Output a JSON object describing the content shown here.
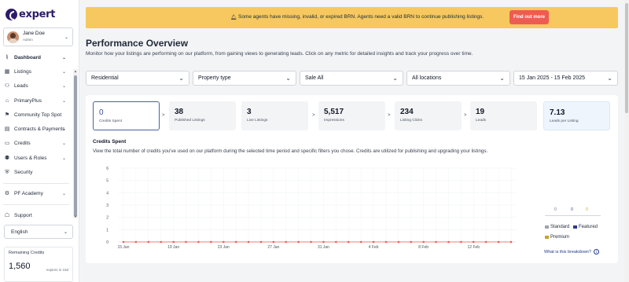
{
  "brand": {
    "name": "expert"
  },
  "user": {
    "name": "Jane Doe",
    "role": "Admin"
  },
  "nav": [
    {
      "label": "Dashboard",
      "icon": "chart-line-icon",
      "glyph": "⌇",
      "chevron": true,
      "active": true
    },
    {
      "label": "Listings",
      "icon": "building-icon",
      "glyph": "▦",
      "chevron": true
    },
    {
      "label": "Leads",
      "icon": "users-icon",
      "glyph": "⚇",
      "chevron": true
    },
    {
      "label": "PrimaryPlus",
      "icon": "primary-plus-icon",
      "glyph": "⌂",
      "chevron": true
    },
    {
      "label": "Community Top Spot",
      "icon": "community-icon",
      "glyph": "⚑",
      "chevron": false
    },
    {
      "label": "Contracts & Payments",
      "icon": "contracts-icon",
      "glyph": "▤",
      "chevron": true
    },
    {
      "label": "Credits",
      "icon": "credits-icon",
      "glyph": "▭",
      "chevron": true
    },
    {
      "label": "Users & Roles",
      "icon": "user-roles-icon",
      "glyph": "⚉",
      "chevron": true
    },
    {
      "label": "Security",
      "icon": "shield-icon",
      "glyph": "⛨",
      "chevron": false
    }
  ],
  "nav2": [
    {
      "label": "PF Academy",
      "icon": "academy-icon",
      "glyph": "⚙",
      "chevron": true
    }
  ],
  "nav3": [
    {
      "label": "Support",
      "icon": "support-icon",
      "glyph": "☖",
      "chevron": false
    }
  ],
  "language": {
    "value": "English"
  },
  "remaining_credits": {
    "title": "Remaining Credits",
    "value": "1,560",
    "expiry": "expires in 15d"
  },
  "banner": {
    "text": "Some agents have missing, invalid, or expired BRN. Agents need a valid BRN to continue publishing listings.",
    "button": "Find out more"
  },
  "page": {
    "title": "Performance Overview",
    "subtitle": "Monitor how your listings are performing on our platform, from gaining views to generating leads. Click on any metric for detailed insights and track your progress over time."
  },
  "filters": {
    "category": "Residential",
    "property_type": "Property type",
    "sale": "Sale All",
    "location": "All locations",
    "date_range": "15 Jan 2025 - 15 Feb 2025"
  },
  "metrics": [
    {
      "value": "0",
      "label": "Credits Spent"
    },
    {
      "value": "38",
      "label": "Published Listings"
    },
    {
      "value": "3",
      "label": "Live Listings"
    },
    {
      "value": "5,517",
      "label": "Impressions"
    },
    {
      "value": "234",
      "label": "Listing Clicks"
    },
    {
      "value": "19",
      "label": "Leads"
    },
    {
      "value": "7.13",
      "label": "Leads per Listing"
    }
  ],
  "section": {
    "title": "Credits Spent",
    "description": "View the total number of credits you've used on our platform during the selected time period and specific filters you chose. Credits are utilized for publishing and upgrading your listings."
  },
  "chart_data": {
    "type": "line",
    "title": "",
    "ylim": [
      0,
      6
    ],
    "yticks": [
      "0",
      "1",
      "2",
      "3",
      "4",
      "5",
      "6"
    ],
    "xticks": [
      "15 Jan",
      "19 Jan",
      "23 Jan",
      "27 Jan",
      "31 Jan",
      "4 Feb",
      "8 Feb",
      "12 Feb"
    ],
    "x": [
      "15 Jan",
      "16 Jan",
      "17 Jan",
      "18 Jan",
      "19 Jan",
      "20 Jan",
      "21 Jan",
      "22 Jan",
      "23 Jan",
      "24 Jan",
      "25 Jan",
      "26 Jan",
      "27 Jan",
      "28 Jan",
      "29 Jan",
      "30 Jan",
      "31 Jan",
      "1 Feb",
      "2 Feb",
      "3 Feb",
      "4 Feb",
      "5 Feb",
      "6 Feb",
      "7 Feb",
      "8 Feb",
      "9 Feb",
      "10 Feb",
      "11 Feb",
      "12 Feb",
      "13 Feb",
      "14 Feb",
      "15 Feb"
    ],
    "series": [
      {
        "values": [
          0,
          0,
          0,
          0,
          0,
          0,
          0,
          0,
          0,
          0,
          0,
          0,
          0,
          0,
          0,
          0,
          0,
          0,
          0,
          0,
          0,
          0,
          0,
          0,
          0,
          0,
          0,
          0,
          0,
          0,
          0,
          0
        ],
        "color": "#ef5b52"
      }
    ],
    "grid": true
  },
  "legend": {
    "totals": [
      {
        "value": "0",
        "color": "#6b7280"
      },
      {
        "value": "0",
        "color": "#2d3a8c"
      },
      {
        "value": "0",
        "color": "#c9a227"
      }
    ],
    "items": [
      {
        "label": "Standard",
        "color": "#9ca3af"
      },
      {
        "label": "Featured",
        "color": "#2d3a8c"
      },
      {
        "label": "Premium",
        "color": "#c9a227"
      }
    ],
    "breakdown_link": "What is this breakdown?"
  },
  "colors": {
    "brand": "#2d1b69",
    "banner": "#f6c85f",
    "cta": "#ef5b52",
    "selected": "#4b5ea8"
  }
}
